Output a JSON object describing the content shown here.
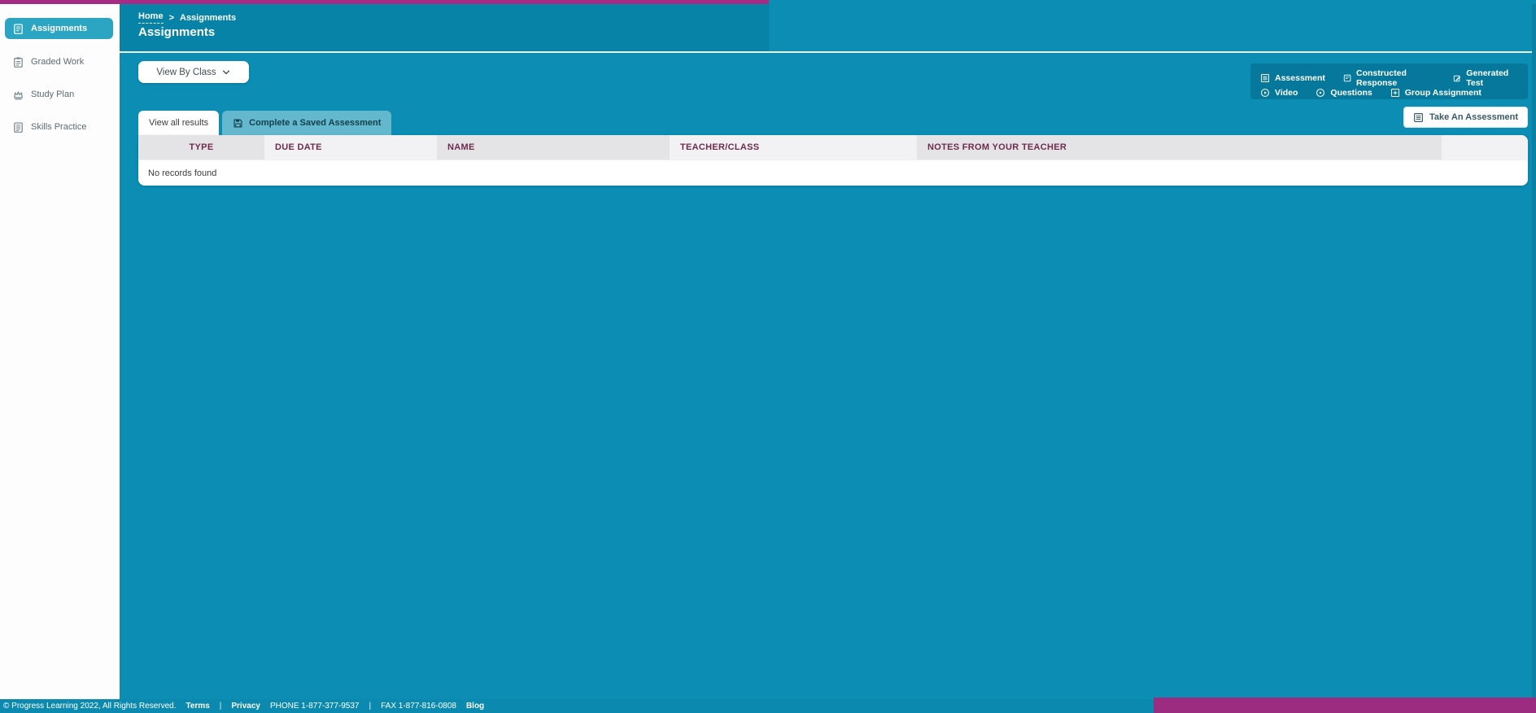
{
  "colors": {
    "main_teal": "#0C8DB4",
    "header_teal": "#0883A8",
    "magenta_top": "#A62B85",
    "magenta_bottom": "#9C2C80",
    "selected_nav": "#2BA5C2",
    "legend_bg": "#06789B",
    "inactive_tab": "#63B8CD",
    "table_header_text": "#6E2B4E",
    "table_header_bg_odd": "#E4E4E7",
    "table_header_bg_even": "#F2F2F4"
  },
  "icons": {
    "assignments-icon": "clipboard with text lines",
    "graded-work-icon": "clipboard with lines",
    "study-plan-icon": "crown",
    "skills-practice-icon": "document with lines",
    "chevron-down-icon": "v chevron",
    "assessment-icon": "square with list lines",
    "constructed-response-icon": "square with two text lines",
    "generated-test-icon": "square with pencil",
    "video-icon": "circle with play triangle",
    "questions-icon": "circle with question mark",
    "group-assignment-icon": "square with plus",
    "save-icon": "floppy disk",
    "take-assessment-icon": "square with list lines"
  },
  "sidebar": {
    "items": [
      {
        "label": "Assignments",
        "active": true
      },
      {
        "label": "Graded Work",
        "active": false
      },
      {
        "label": "Study Plan",
        "active": false
      },
      {
        "label": "Skills Practice",
        "active": false
      }
    ]
  },
  "header": {
    "breadcrumb": {
      "home": "Home",
      "separator": ">",
      "current": "Assignments"
    },
    "title": "Assignments"
  },
  "toolbar": {
    "view_by_class_label": "View By Class"
  },
  "legend": {
    "items": [
      {
        "label": "Assessment"
      },
      {
        "label": "Constructed Response"
      },
      {
        "label": "Generated Test"
      },
      {
        "label": "Video"
      },
      {
        "label": "Questions"
      },
      {
        "label": "Group Assignment"
      }
    ]
  },
  "actions": {
    "take_assessment_label": "Take An Assessment"
  },
  "tabs": [
    {
      "label": "View all results",
      "active": true
    },
    {
      "label": "Complete a Saved Assessment",
      "active": false
    }
  ],
  "table": {
    "columns": [
      "TYPE",
      "DUE DATE",
      "NAME",
      "TEACHER/CLASS",
      "NOTES FROM YOUR TEACHER",
      ""
    ],
    "empty_message": "No records found",
    "rows": []
  },
  "footer": {
    "copyright": "© Progress Learning 2022, All Rights Reserved.",
    "terms": "Terms",
    "privacy": "Privacy",
    "phone": "PHONE 1-877-377-9537",
    "fax": "FAX 1-877-816-0808",
    "blog": "Blog",
    "separator": "|"
  }
}
